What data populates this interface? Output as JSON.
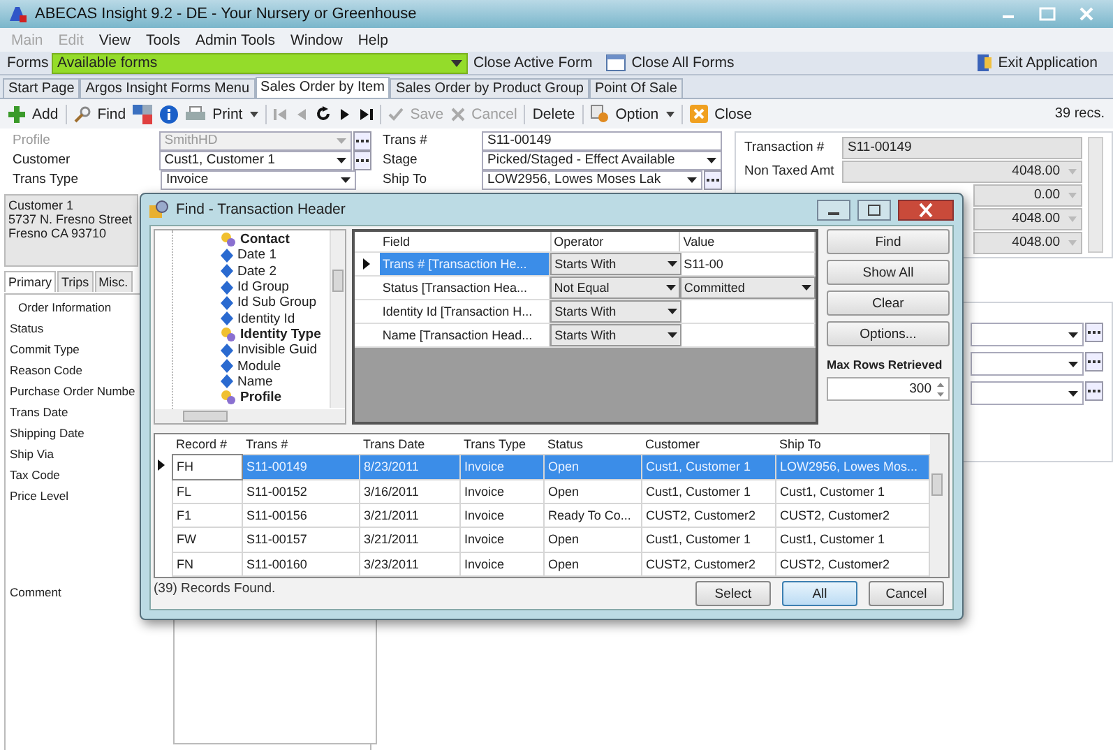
{
  "window": {
    "title": "ABECAS Insight 9.2 - DE - Your Nursery or Greenhouse"
  },
  "menu": [
    {
      "label": "Main",
      "disabled": true
    },
    {
      "label": "Edit",
      "disabled": true
    },
    {
      "label": "View",
      "disabled": false
    },
    {
      "label": "Tools",
      "disabled": false
    },
    {
      "label": "Admin Tools",
      "disabled": false
    },
    {
      "label": "Window",
      "disabled": false
    },
    {
      "label": "Help",
      "disabled": false
    }
  ],
  "forms_bar": {
    "label": "Forms",
    "value": "Available forms",
    "close_active": "Close Active Form",
    "close_all": "Close All Forms",
    "exit": "Exit Application"
  },
  "tabs": [
    {
      "label": "Start Page",
      "selected": false
    },
    {
      "label": "Argos Insight Forms Menu",
      "selected": false
    },
    {
      "label": "Sales Order by Item",
      "selected": true
    },
    {
      "label": "Sales Order by Product Group",
      "selected": false
    },
    {
      "label": "Point Of Sale",
      "selected": false
    }
  ],
  "toolbar": {
    "add": "Add",
    "find": "Find",
    "print": "Print",
    "save": {
      "label": "Save",
      "disabled": true
    },
    "cancel": {
      "label": "Cancel",
      "disabled": true
    },
    "delete": "Delete",
    "option": "Option",
    "close": "Close",
    "records": "39 recs."
  },
  "header_fields": [
    {
      "label": "Profile",
      "value": "SmithHD",
      "disabled": true,
      "kind": "lookup"
    },
    {
      "label": "Customer",
      "value": "Cust1, Customer 1",
      "disabled": false,
      "kind": "lookup"
    },
    {
      "label": "Trans Type",
      "value": "Invoice",
      "disabled": false,
      "kind": "combo"
    }
  ],
  "middle_fields": [
    {
      "label": "Trans #",
      "value": "S11-00149",
      "kind": "text"
    },
    {
      "label": "Stage",
      "value": "Picked/Staged - Effect Available",
      "kind": "combo"
    },
    {
      "label": "Ship To",
      "value": "LOW2956, Lowes Moses Lak",
      "kind": "lookup"
    }
  ],
  "address": [
    "Customer 1",
    "5737 N. Fresno Street",
    "Fresno CA 93710"
  ],
  "detail_tabs": [
    {
      "label": "Primary",
      "selected": true
    },
    {
      "label": "Trips",
      "selected": false
    },
    {
      "label": "Misc.",
      "selected": false
    }
  ],
  "detail_labels": [
    "Order Information",
    "Status",
    "Commit Type",
    "Reason Code",
    "Purchase Order Numbe",
    "Trans Date",
    "Shipping Date",
    "Ship Via",
    "Tax Code",
    "Price Level"
  ],
  "comment_label": "Comment",
  "totals": [
    {
      "label": "Transaction #",
      "value": "S11-00149",
      "kind": "text"
    },
    {
      "label": "Non Taxed Amt",
      "value": "4048.00",
      "kind": "amount"
    },
    {
      "value": "0.00",
      "kind": "amount"
    },
    {
      "value": "4048.00",
      "kind": "amount"
    },
    {
      "value": "4048.00",
      "kind": "amount"
    }
  ],
  "dialog": {
    "title": "Find - Transaction Header",
    "tree": [
      {
        "label": "Contact",
        "kind": "group"
      },
      {
        "label": "Date 1",
        "kind": "field"
      },
      {
        "label": "Date 2",
        "kind": "field"
      },
      {
        "label": "Id Group",
        "kind": "field"
      },
      {
        "label": "Id Sub Group",
        "kind": "field"
      },
      {
        "label": "Identity Id",
        "kind": "field"
      },
      {
        "label": "Identity Type",
        "kind": "group"
      },
      {
        "label": "Invisible Guid",
        "kind": "field"
      },
      {
        "label": "Module",
        "kind": "field"
      },
      {
        "label": "Name",
        "kind": "field"
      },
      {
        "label": "Profile",
        "kind": "group"
      }
    ],
    "criteria_columns": [
      "Field",
      "Operator",
      "Value"
    ],
    "criteria": [
      {
        "field": "Trans # [Transaction He...",
        "operator": "Starts With",
        "value": "S11-00",
        "kind": "text",
        "selected": true
      },
      {
        "field": "Status [Transaction Hea...",
        "operator": "Not Equal",
        "value": "Committed",
        "kind": "combo",
        "selected": false
      },
      {
        "field": "Identity Id [Transaction H...",
        "operator": "Starts With",
        "kind": "text",
        "selected": false
      },
      {
        "field": "Name [Transaction Head...",
        "operator": "Starts With",
        "kind": "text",
        "selected": false
      }
    ],
    "buttons": [
      "Find",
      "Show All",
      "Clear",
      "Options..."
    ],
    "max_rows": {
      "label": "Max Rows Retrieved",
      "value": "300"
    },
    "result_columns": [
      "Record #",
      "Trans #",
      "Trans Date",
      "Trans Type",
      "Status",
      "Customer",
      "Ship To"
    ],
    "results": [
      {
        "cells": [
          "FH",
          "S11-00149",
          "8/23/2011",
          "Invoice",
          "Open",
          "Cust1, Customer 1",
          "LOW2956, Lowes Mos..."
        ],
        "selected": true
      },
      {
        "cells": [
          "FL",
          "S11-00152",
          "3/16/2011",
          "Invoice",
          "Open",
          "Cust1, Customer 1",
          "Cust1, Customer 1"
        ],
        "selected": false
      },
      {
        "cells": [
          "F1",
          "S11-00156",
          "3/21/2011",
          "Invoice",
          "Ready To Co...",
          "CUST2, Customer2",
          "CUST2, Customer2"
        ],
        "selected": false
      },
      {
        "cells": [
          "FW",
          "S11-00157",
          "3/21/2011",
          "Invoice",
          "Open",
          "Cust1, Customer 1",
          "Cust1, Customer 1"
        ],
        "selected": false
      },
      {
        "cells": [
          "FN",
          "S11-00160",
          "3/23/2011",
          "Invoice",
          "Open",
          "CUST2, Customer2",
          "CUST2, Customer2"
        ],
        "selected": false
      }
    ],
    "status": "(39) Records Found.",
    "footer_buttons": [
      {
        "label": "Select",
        "hover": false
      },
      {
        "label": "All",
        "hover": true
      },
      {
        "label": "Cancel",
        "hover": false
      }
    ]
  }
}
